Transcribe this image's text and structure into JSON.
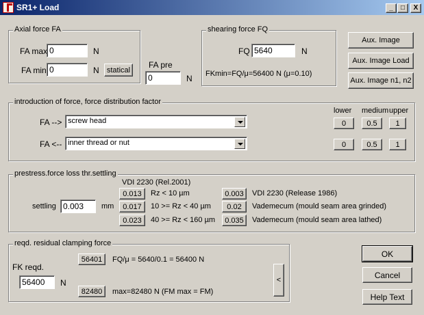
{
  "window": {
    "title": "SR1+ Load",
    "controls": {
      "minimize": "_",
      "maximize": "□",
      "close": "X"
    }
  },
  "axial": {
    "legend": "Axial force FA",
    "famax_label": "FA max",
    "famax_value": "0",
    "famax_unit": "N",
    "famin_label": "FA min",
    "famin_value": "0",
    "famin_unit": "N",
    "statical_button": "statical"
  },
  "fapre": {
    "label": "FA pre",
    "value": "0",
    "unit": "N"
  },
  "shearing": {
    "legend": "shearing force FQ",
    "fq_label": "FQ",
    "fq_value": "5640",
    "fq_unit": "N",
    "fkmin_text": "FKmin=FQ/μ=56400 N  (μ=0.10)"
  },
  "aux": {
    "image": "Aux. Image",
    "image_load": "Aux. Image Load",
    "image_n1n2": "Aux. Image n1, n2"
  },
  "introduction": {
    "legend": "introduction of force, force distribution factor",
    "col_lower": "lower",
    "col_medium": "medium",
    "col_upper": "upper",
    "rows": [
      {
        "label": "FA  -->",
        "selected": "screw head",
        "lower": "0",
        "medium": "0.5",
        "upper": "1"
      },
      {
        "label": "FA  <--",
        "selected": "inner thread or nut",
        "lower": "0",
        "medium": "0.5",
        "upper": "1"
      }
    ]
  },
  "prestress": {
    "legend": "prestress.force loss thr.settling",
    "vdi_header": "VDI 2230 (Rel.2001)",
    "settling_label": "settling",
    "settling_value": "0.003",
    "settling_unit": "mm",
    "left_rows": [
      {
        "value": "0.013",
        "desc": "Rz < 10 µm"
      },
      {
        "value": "0.017",
        "desc": "10 >= Rz < 40 µm"
      },
      {
        "value": "0.023",
        "desc": "40 >= Rz < 160 µm"
      }
    ],
    "right_rows": [
      {
        "value": "0.003",
        "desc": "VDI 2230 (Release 1986)"
      },
      {
        "value": "0.02",
        "desc": "Vademecum (mould seam area grinded)"
      },
      {
        "value": "0.035",
        "desc": "Vademecum (mould seam area lathed)"
      }
    ]
  },
  "clamping": {
    "legend": "reqd. residual clamping force",
    "fk_label": "FK reqd.",
    "fk_value": "56400",
    "fk_unit": "N",
    "btn1": "56401",
    "btn1_text": "FQ/μ = 5640/0.1 = 56400 N",
    "btn2": "82480",
    "btn2_text": "max=82480 N  (FM max = FM)",
    "side_button": "<"
  },
  "actions": {
    "ok": "OK",
    "cancel": "Cancel",
    "help": "Help Text"
  }
}
